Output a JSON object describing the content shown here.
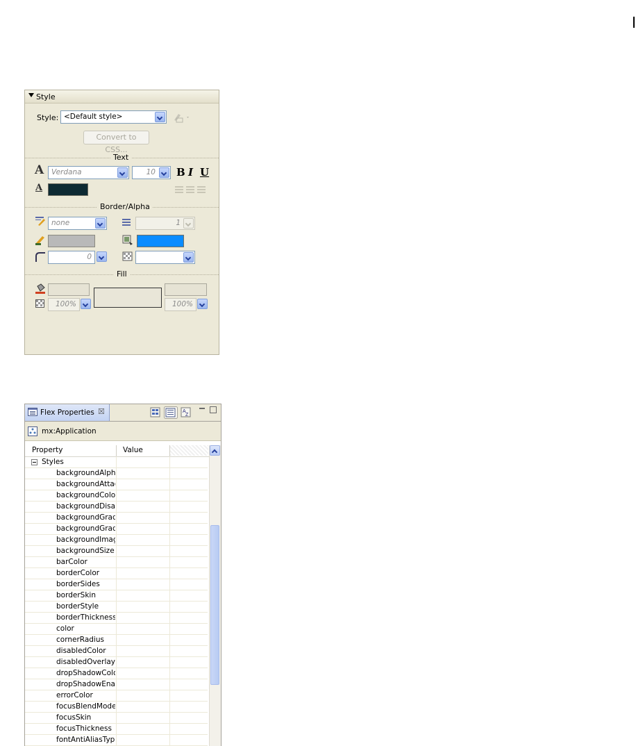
{
  "style_panel": {
    "title": "Style",
    "style_label": "Style:",
    "style_value": "<Default style>",
    "convert_button": "Convert to CSS...",
    "section_text": "Text",
    "font_value": "Verdana",
    "size_value": "10",
    "bold": "B",
    "italic": "I",
    "underline": "U",
    "text_color": "#0d2a33",
    "section_border": "Border/Alpha",
    "border_style_value": "none",
    "border_thickness_value": "1",
    "border_color": "#b9b9b9",
    "theme_color": "#0a8cff",
    "corner_radius_value": "0",
    "alpha_value": "",
    "section_fill": "Fill",
    "fill_alpha_left": "100%",
    "fill_alpha_right": "100%"
  },
  "flex_properties": {
    "tab_label": "Flex Properties",
    "tab_close": "☒",
    "component": "mx:Application",
    "col_property": "Property",
    "col_value": "Value",
    "group": "Styles",
    "rows": [
      "backgroundAlpha",
      "backgroundAttach",
      "backgroundColor",
      "backgroundDisable",
      "backgroundGradie",
      "backgroundGradie",
      "backgroundImage",
      "backgroundSize",
      "barColor",
      "borderColor",
      "borderSides",
      "borderSkin",
      "borderStyle",
      "borderThickness",
      "color",
      "cornerRadius",
      "disabledColor",
      "disabledOverlayAl",
      "dropShadowColor",
      "dropShadowEnabl",
      "errorColor",
      "focusBlendMode",
      "focusSkin",
      "focusThickness",
      "fontAntiAliasType"
    ]
  }
}
